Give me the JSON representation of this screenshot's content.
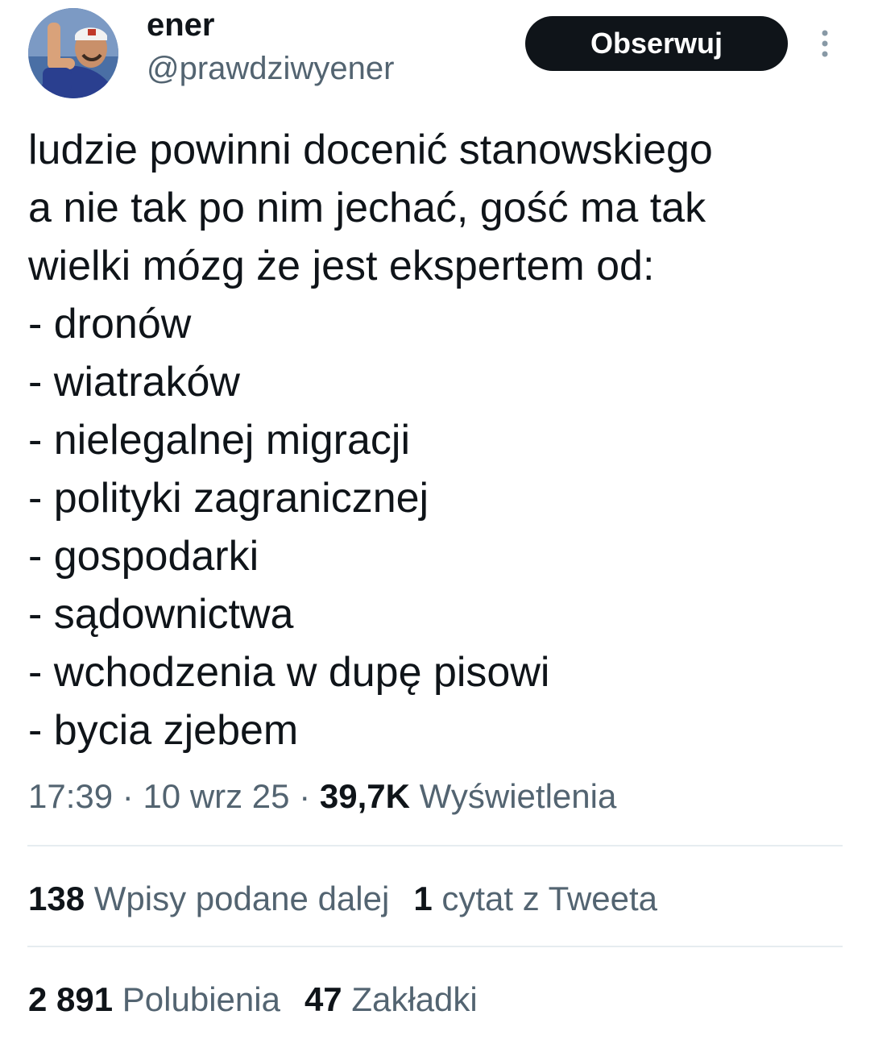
{
  "author": {
    "display_name": "ener",
    "handle": "@prawdziwyener",
    "avatar_icon": "user-avatar"
  },
  "actions": {
    "follow_label": "Obserwuj",
    "more_icon": "vertical-ellipsis-icon"
  },
  "tweet": {
    "lines": [
      "ludzie powinni docenić stanowskiego",
      "a nie tak po nim jechać, gość ma tak",
      "wielki mózg że jest ekspertem od:",
      "- dronów",
      "- wiatraków",
      "- nielegalnej migracji",
      "- polityki zagranicznej",
      "- gospodarki",
      "- sądownictwa",
      "- wchodzenia w dupę pisowi",
      "- bycia zjebem"
    ]
  },
  "meta": {
    "time": "17:39",
    "separator": " · ",
    "date": "10 wrz 25",
    "views_count": "39,7K",
    "views_label": "Wyświetlenia"
  },
  "stats": {
    "retweets_count": "138",
    "retweets_label": "Wpisy podane dalej",
    "quotes_count": "1",
    "quotes_label": "cytat z Tweeta",
    "likes_count": "2 891",
    "likes_label": "Polubienia",
    "bookmarks_count": "47",
    "bookmarks_label": "Zakładki"
  },
  "colors": {
    "text_primary": "#0f1419",
    "text_secondary": "#536471",
    "divider": "#e6ecf0",
    "follow_button_bg": "#0f1419",
    "follow_button_text": "#ffffff"
  }
}
